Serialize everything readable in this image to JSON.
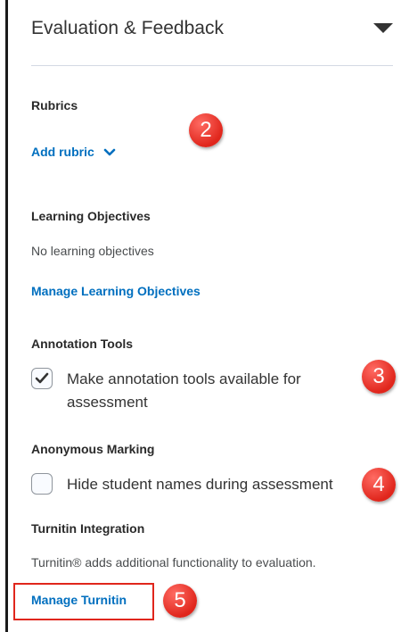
{
  "header": {
    "title": "Evaluation & Feedback",
    "collapse_icon": "triangle-down-icon"
  },
  "rubrics": {
    "label": "Rubrics",
    "add_link": "Add rubric",
    "add_icon": "chevron-down-icon"
  },
  "learning_objectives": {
    "label": "Learning Objectives",
    "empty_text": "No learning objectives",
    "manage_link": "Manage Learning Objectives"
  },
  "annotation_tools": {
    "label": "Annotation Tools",
    "checkbox_label_line1": "Make annotation tools available for",
    "checkbox_label_line2": "assessment",
    "checked": true
  },
  "anonymous_marking": {
    "label": "Anonymous Marking",
    "checkbox_label": "Hide student names during assessment",
    "checked": false
  },
  "turnitin": {
    "label": "Turnitin Integration",
    "description": "Turnitin® adds additional functionality to evaluation.",
    "manage_link": "Manage Turnitin"
  },
  "callouts": {
    "c2": "2",
    "c3": "3",
    "c4": "4",
    "c5": "5"
  },
  "colors": {
    "link": "#006fbf",
    "callout": "#e0261c"
  }
}
